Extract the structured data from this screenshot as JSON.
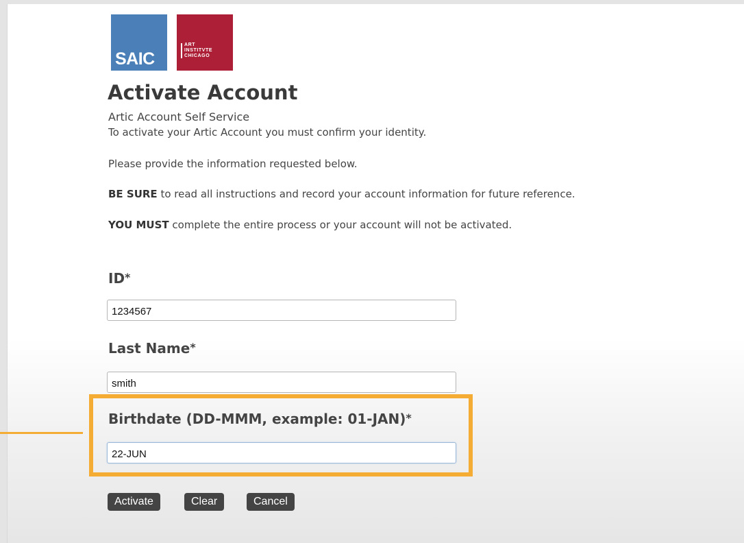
{
  "logos": {
    "saic": "SAIC",
    "art_institute": [
      "ART",
      "INSTITVTE",
      "CHICAGO"
    ],
    "colors": {
      "saic_blue": "#4a7fb7",
      "aic_red": "#ad1f36"
    }
  },
  "header": {
    "title": "Activate Account",
    "subtitle": "Artic Account Self Service"
  },
  "instructions": {
    "line1": "To activate your Artic Account you must confirm your identity.",
    "line2": "Please provide the information requested below.",
    "line3_bold": "BE SURE",
    "line3_rest": " to read all instructions and record your account information for future reference.",
    "line4_bold": "YOU MUST",
    "line4_rest": " complete the entire process or your account will not be activated."
  },
  "form": {
    "id": {
      "label": "ID",
      "required_mark": "*",
      "value": "1234567"
    },
    "last_name": {
      "label": "Last Name",
      "required_mark": "*",
      "value": "smith"
    },
    "birthdate": {
      "label": "Birthdate (DD-MMM, example: 01-JAN)",
      "required_mark": "*",
      "value": "22-JUN"
    }
  },
  "buttons": {
    "activate": "Activate",
    "clear": "Clear",
    "cancel": "Cancel"
  },
  "highlight_color": "#f4ac35"
}
